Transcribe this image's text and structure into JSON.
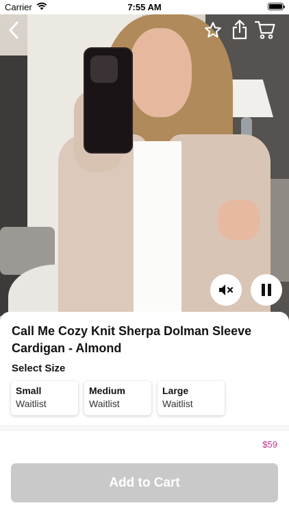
{
  "status_bar": {
    "carrier": "Carrier",
    "time": "7:55 AM"
  },
  "video": {
    "icons": {
      "back": "chevron-left-icon",
      "favorite": "star-outline-icon",
      "share": "share-icon",
      "cart": "cart-icon",
      "mute": "speaker-muted-icon",
      "pause": "pause-icon"
    }
  },
  "product": {
    "title": "Call Me Cozy Knit Sherpa Dolman Sleeve Cardigan - Almond",
    "select_size_label": "Select Size",
    "sizes": [
      {
        "name": "Small",
        "status": "Waitlist"
      },
      {
        "name": "Medium",
        "status": "Waitlist"
      },
      {
        "name": "Large",
        "status": "Waitlist"
      }
    ],
    "price": "$59",
    "add_to_cart_label": "Add to Cart"
  },
  "colors": {
    "price": "#c0328f",
    "disabled_button": "#c9c9c9"
  }
}
